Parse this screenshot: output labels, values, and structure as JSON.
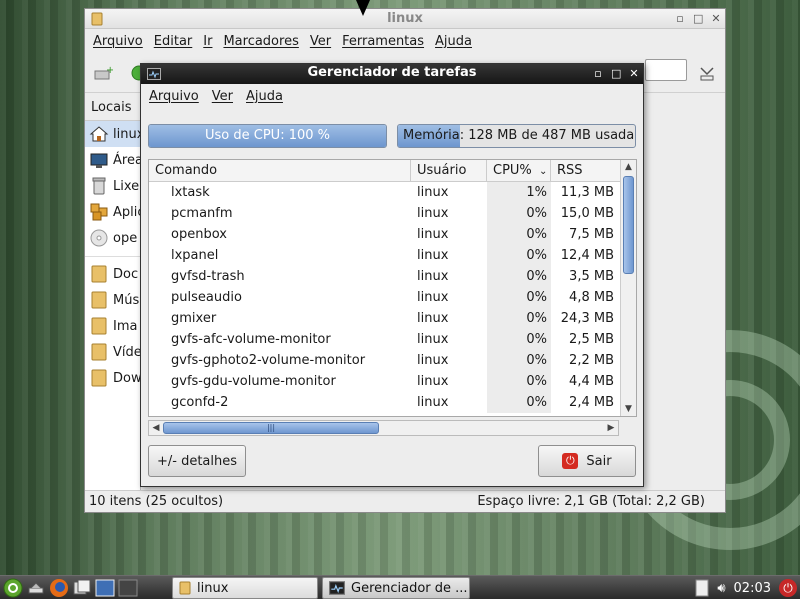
{
  "file_manager": {
    "title": "linux",
    "menu": [
      "Arquivo",
      "Editar",
      "Ir",
      "Marcadores",
      "Ver",
      "Ferramentas",
      "Ajuda"
    ],
    "sidebar_heading": "Locais",
    "places": [
      {
        "label": "linux",
        "icon": "home-icon"
      },
      {
        "label": "Área",
        "icon": "desktop-icon"
      },
      {
        "label": "Lixe",
        "icon": "trash-icon"
      },
      {
        "label": "Aplic",
        "icon": "applications-icon"
      },
      {
        "label": "ope",
        "icon": "disc-icon"
      }
    ],
    "bookmarks": [
      "Doc",
      "Mús",
      "Ima",
      "Víde",
      "Dow"
    ],
    "status_left": "10 itens (25 ocultos)",
    "status_right": "Espaço livre: 2,1 GB (Total: 2,2 GB)"
  },
  "task_manager": {
    "title": "Gerenciador de tarefas",
    "menu": [
      "Arquivo",
      "Ver",
      "Ajuda"
    ],
    "cpu_label": "Uso de CPU: 100 %",
    "cpu_fraction": 1.0,
    "mem_label": "Memória: 128 MB de 487 MB usada",
    "mem_fraction": 0.263,
    "columns": [
      "Comando",
      "Usuário",
      "CPU%",
      "RSS"
    ],
    "processes": [
      {
        "cmd": "lxtask",
        "user": "linux",
        "cpu": "1%",
        "rss": "11,3 MB"
      },
      {
        "cmd": "pcmanfm",
        "user": "linux",
        "cpu": "0%",
        "rss": "15,0 MB"
      },
      {
        "cmd": "openbox",
        "user": "linux",
        "cpu": "0%",
        "rss": "7,5 MB"
      },
      {
        "cmd": "lxpanel",
        "user": "linux",
        "cpu": "0%",
        "rss": "12,4 MB"
      },
      {
        "cmd": "gvfsd-trash",
        "user": "linux",
        "cpu": "0%",
        "rss": "3,5 MB"
      },
      {
        "cmd": "pulseaudio",
        "user": "linux",
        "cpu": "0%",
        "rss": "4,8 MB"
      },
      {
        "cmd": "gmixer",
        "user": "linux",
        "cpu": "0%",
        "rss": "24,3 MB"
      },
      {
        "cmd": "gvfs-afc-volume-monitor",
        "user": "linux",
        "cpu": "0%",
        "rss": "2,5 MB"
      },
      {
        "cmd": "gvfs-gphoto2-volume-monitor",
        "user": "linux",
        "cpu": "0%",
        "rss": "2,2 MB"
      },
      {
        "cmd": "gvfs-gdu-volume-monitor",
        "user": "linux",
        "cpu": "0%",
        "rss": "4,4 MB"
      },
      {
        "cmd": "gconfd-2",
        "user": "linux",
        "cpu": "0%",
        "rss": "2,4 MB"
      }
    ],
    "details_button": "+/- detalhes",
    "quit_button": "Sair"
  },
  "taskbar": {
    "tasks": [
      "linux",
      "Gerenciador de ..."
    ],
    "clock": "02:03"
  },
  "colors": {
    "selection": "#cfdff3",
    "meter_fill": "#6d96cf",
    "quit_icon": "#d42a20"
  }
}
